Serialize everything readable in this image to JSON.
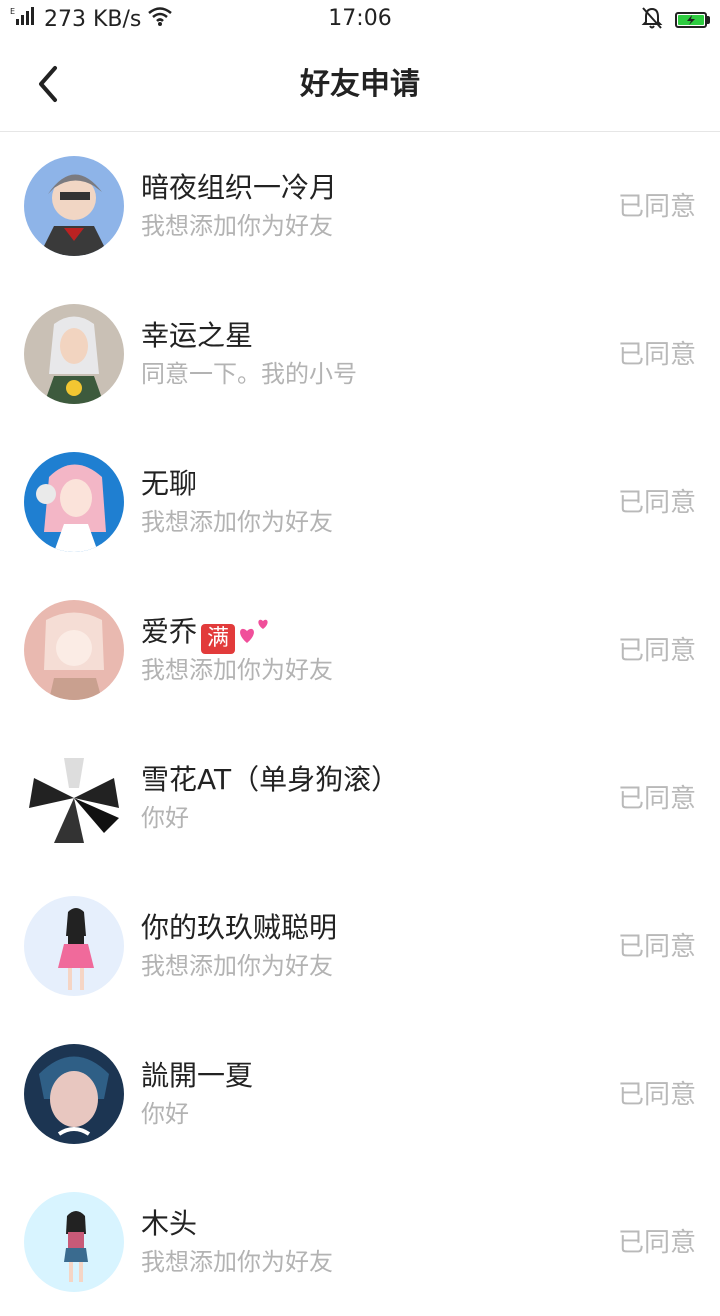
{
  "status_bar": {
    "network_speed": "273 KB/s",
    "time": "17:06",
    "icons": [
      "signal-icon",
      "wifi-icon",
      "mute-icon",
      "battery-charging-icon"
    ]
  },
  "header": {
    "title": "好友申请",
    "back_icon": "chevron-left-icon"
  },
  "requests": [
    {
      "name": "暗夜组织一冷月",
      "message": "我想添加你为好友",
      "status": "已同意",
      "avatar_colors": [
        "#8eb4e8",
        "#555"
      ]
    },
    {
      "name": "幸运之星",
      "message": "同意一下。我的小号",
      "status": "已同意",
      "avatar_colors": [
        "#c9c0b5",
        "#3d5a3d"
      ]
    },
    {
      "name": "无聊",
      "message": "我想添加你为好友",
      "status": "已同意",
      "avatar_colors": [
        "#1f7fd1",
        "#f3b6c6"
      ]
    },
    {
      "name": "爱乔",
      "name_badge": "满",
      "message": "我想添加你为好友",
      "status": "已同意",
      "avatar_colors": [
        "#e9b9b0",
        "#f7e3d8"
      ]
    },
    {
      "name": "雪花AT（单身狗滚）",
      "message": "你好",
      "status": "已同意",
      "avatar_colors": [
        "#ffffff",
        "#222"
      ]
    },
    {
      "name": "你的玖玖贼聪明",
      "message": "我想添加你为好友",
      "status": "已同意",
      "avatar_colors": [
        "#e6effc",
        "#f06a9b"
      ]
    },
    {
      "name": "詤開一夏",
      "message": "你好",
      "status": "已同意",
      "avatar_colors": [
        "#1c3552",
        "#e8c7c0"
      ]
    },
    {
      "name": "木头",
      "message": "我想添加你为好友",
      "status": "已同意",
      "avatar_colors": [
        "#d8f4ff",
        "#3a6b8f"
      ]
    }
  ]
}
